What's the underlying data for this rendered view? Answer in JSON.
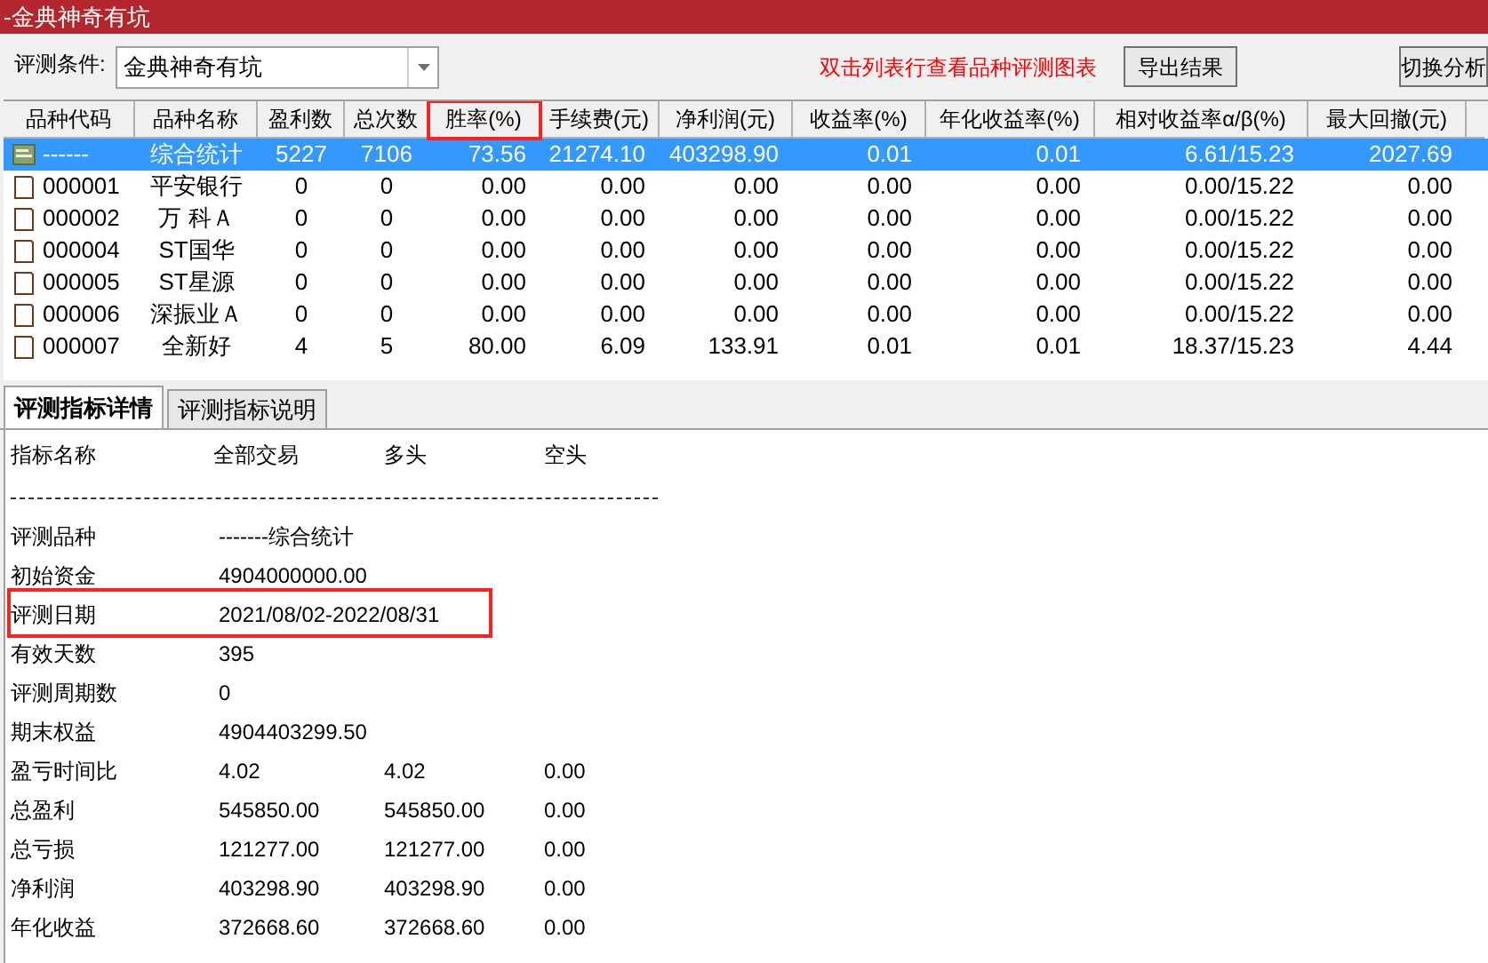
{
  "window": {
    "title": "-金典神奇有坑"
  },
  "toolbar": {
    "condition_label": "评测条件:",
    "condition_value": "金典神奇有坑",
    "hint": "双击列表行查看品种评测图表",
    "buttons": [
      "导出结果",
      "切换分析"
    ]
  },
  "table": {
    "columns": [
      {
        "label": "品种代码",
        "highlighted": false
      },
      {
        "label": "品种名称",
        "highlighted": false
      },
      {
        "label": "盈利数",
        "highlighted": false
      },
      {
        "label": "总次数",
        "highlighted": false
      },
      {
        "label": "胜率(%)",
        "highlighted": true
      },
      {
        "label": "手续费(元)",
        "highlighted": false
      },
      {
        "label": "净利润(元)",
        "highlighted": false
      },
      {
        "label": "收益率(%)",
        "highlighted": false
      },
      {
        "label": "年化收益率(%)",
        "highlighted": false
      },
      {
        "label": "相对收益率α/β(%)",
        "highlighted": false
      },
      {
        "label": "最大回撤(元)",
        "highlighted": false
      }
    ],
    "rows": [
      {
        "kind": "summary",
        "selected": true,
        "cells": [
          "------",
          "综合统计",
          "5227",
          "7106",
          "73.56",
          "21274.10",
          "403298.90",
          "0.01",
          "0.01",
          "6.61/15.23",
          "2027.69"
        ]
      },
      {
        "kind": "stock",
        "selected": false,
        "cells": [
          "000001",
          "平安银行",
          "0",
          "0",
          "0.00",
          "0.00",
          "0.00",
          "0.00",
          "0.00",
          "0.00/15.22",
          "0.00"
        ]
      },
      {
        "kind": "stock",
        "selected": false,
        "cells": [
          "000002",
          "万 科Ａ",
          "0",
          "0",
          "0.00",
          "0.00",
          "0.00",
          "0.00",
          "0.00",
          "0.00/15.22",
          "0.00"
        ]
      },
      {
        "kind": "stock",
        "selected": false,
        "cells": [
          "000004",
          "ST国华",
          "0",
          "0",
          "0.00",
          "0.00",
          "0.00",
          "0.00",
          "0.00",
          "0.00/15.22",
          "0.00"
        ]
      },
      {
        "kind": "stock",
        "selected": false,
        "cells": [
          "000005",
          "ST星源",
          "0",
          "0",
          "0.00",
          "0.00",
          "0.00",
          "0.00",
          "0.00",
          "0.00/15.22",
          "0.00"
        ]
      },
      {
        "kind": "stock",
        "selected": false,
        "cells": [
          "000006",
          "深振业Ａ",
          "0",
          "0",
          "0.00",
          "0.00",
          "0.00",
          "0.00",
          "0.00",
          "0.00/15.22",
          "0.00"
        ]
      },
      {
        "kind": "stock",
        "selected": false,
        "cells": [
          "000007",
          "全新好",
          "4",
          "5",
          "80.00",
          "6.09",
          "133.91",
          "0.01",
          "0.01",
          "18.37/15.23",
          "4.44"
        ]
      }
    ]
  },
  "tabs": [
    {
      "label": "评测指标详情",
      "selected": true
    },
    {
      "label": "评测指标说明",
      "selected": false
    }
  ],
  "details": {
    "header": [
      "指标名称",
      "全部交易",
      "多头",
      "空头"
    ],
    "rows": [
      {
        "label": "评测品种",
        "values": [
          "-------综合统计"
        ],
        "highlighted": false
      },
      {
        "label": "初始资金",
        "values": [
          "4904000000.00"
        ],
        "highlighted": false
      },
      {
        "label": "评测日期",
        "values": [
          "2021/08/02-2022/08/31"
        ],
        "highlighted": true
      },
      {
        "label": "有效天数",
        "values": [
          "395"
        ],
        "highlighted": false
      },
      {
        "label": "评测周期数",
        "values": [
          "0"
        ],
        "highlighted": false
      },
      {
        "label": "期末权益",
        "values": [
          "4904403299.50"
        ],
        "highlighted": false
      },
      {
        "label": "盈亏时间比",
        "values": [
          "4.02",
          "4.02",
          "0.00"
        ],
        "highlighted": false
      },
      {
        "label": "总盈利",
        "values": [
          "545850.00",
          "545850.00",
          "0.00"
        ],
        "highlighted": false
      },
      {
        "label": "总亏损",
        "values": [
          "121277.00",
          "121277.00",
          "0.00"
        ],
        "highlighted": false
      },
      {
        "label": "净利润",
        "values": [
          "403298.90",
          "403298.90",
          "0.00"
        ],
        "highlighted": false
      },
      {
        "label": "年化收益",
        "values": [
          "372668.60",
          "372668.60",
          "0.00"
        ],
        "highlighted": false
      }
    ]
  }
}
